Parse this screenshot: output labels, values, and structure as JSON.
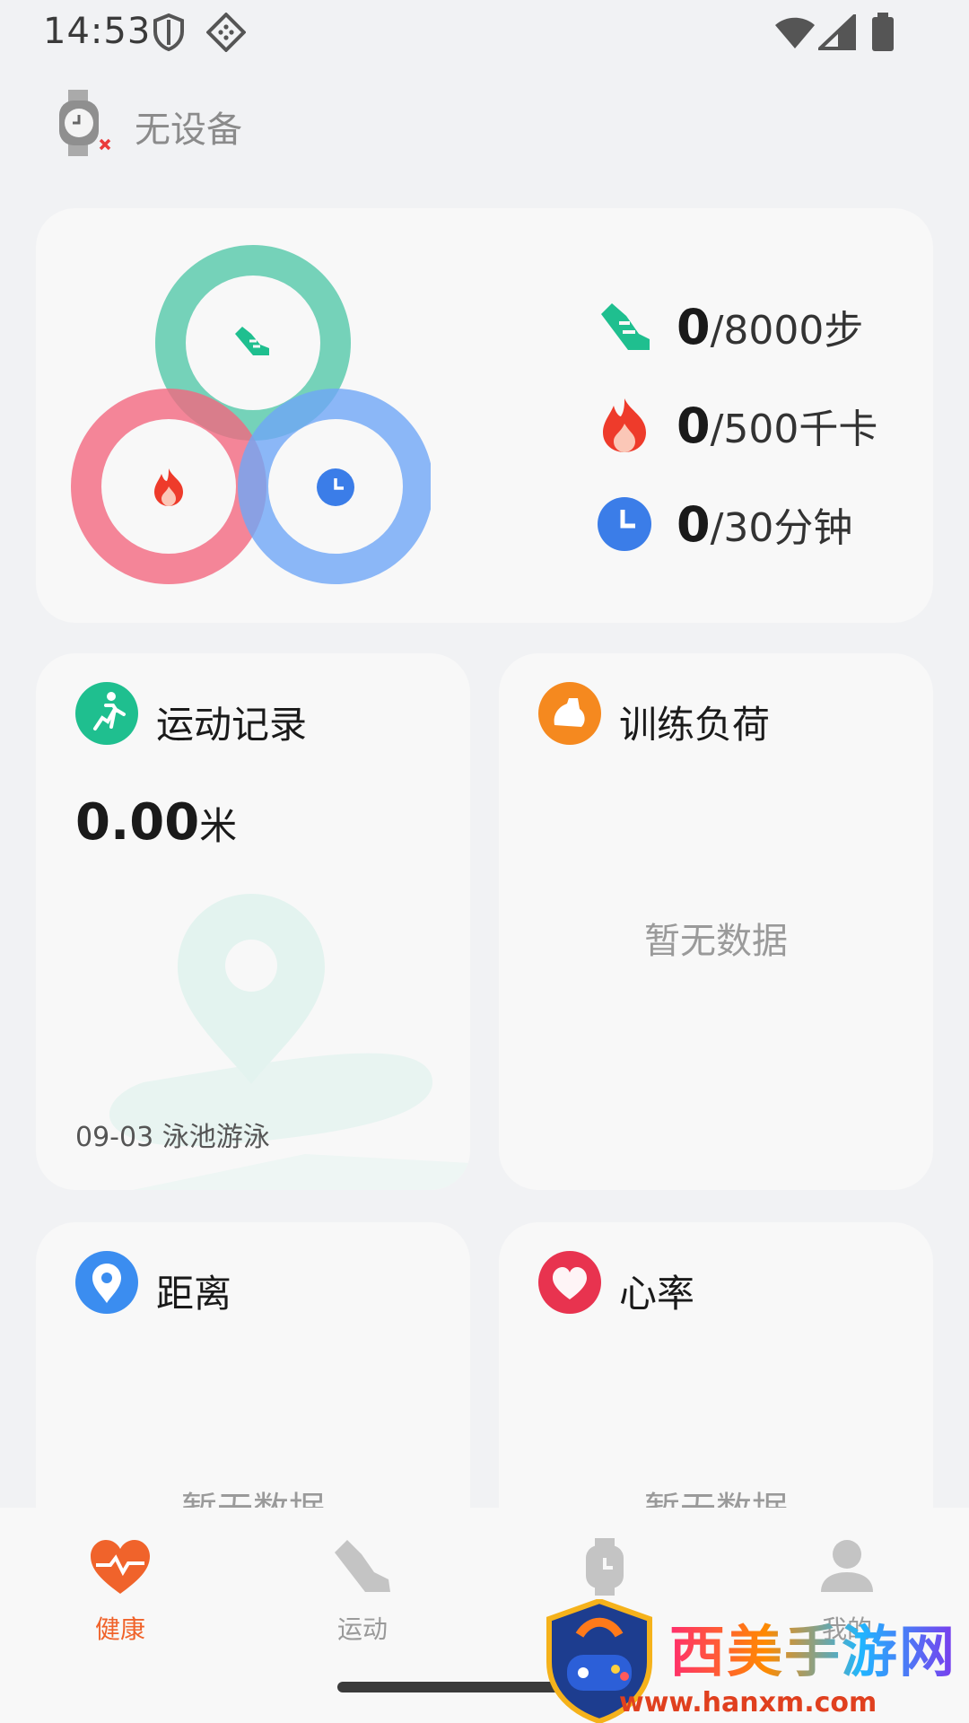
{
  "status_bar": {
    "time": "14:53",
    "icons": [
      "shield-icon",
      "apps-icon",
      "wifi-icon",
      "signal-icon",
      "battery-icon"
    ]
  },
  "device": {
    "label": "无设备",
    "icon": "watch-disconnected-icon"
  },
  "activity": {
    "rings": [
      "steps-ring",
      "calories-ring",
      "duration-ring"
    ],
    "goals": [
      {
        "current": "0",
        "target": "/8000步",
        "icon": "shoe-icon",
        "color": "#1fbf8f"
      },
      {
        "current": "0",
        "target": "/500千卡",
        "icon": "flame-icon",
        "color": "#f0472b"
      },
      {
        "current": "0",
        "target": "/30分钟",
        "icon": "clock-icon",
        "color": "#3b7de8"
      }
    ]
  },
  "cards": {
    "exercise_record": {
      "title": "运动记录",
      "value": "0.00",
      "unit": "米",
      "last": "09-03 泳池游泳"
    },
    "training_load": {
      "title": "训练负荷",
      "empty": "暂无数据"
    },
    "distance": {
      "title": "距离",
      "empty": "暂无数据"
    },
    "heart_rate": {
      "title": "心率",
      "empty": "暂无数据"
    }
  },
  "nav": {
    "items": [
      {
        "label": "健康",
        "active": true
      },
      {
        "label": "运动",
        "active": false
      },
      {
        "label": "设备",
        "active": false
      },
      {
        "label": "我的",
        "active": false
      }
    ]
  },
  "watermark": {
    "title": "西美手游网",
    "url": "www.hanxm.com"
  },
  "colors": {
    "accent": "#f0632b",
    "green": "#1fbf8f",
    "red": "#f0472b",
    "blue": "#3b7de8",
    "orange": "#f5891f"
  }
}
